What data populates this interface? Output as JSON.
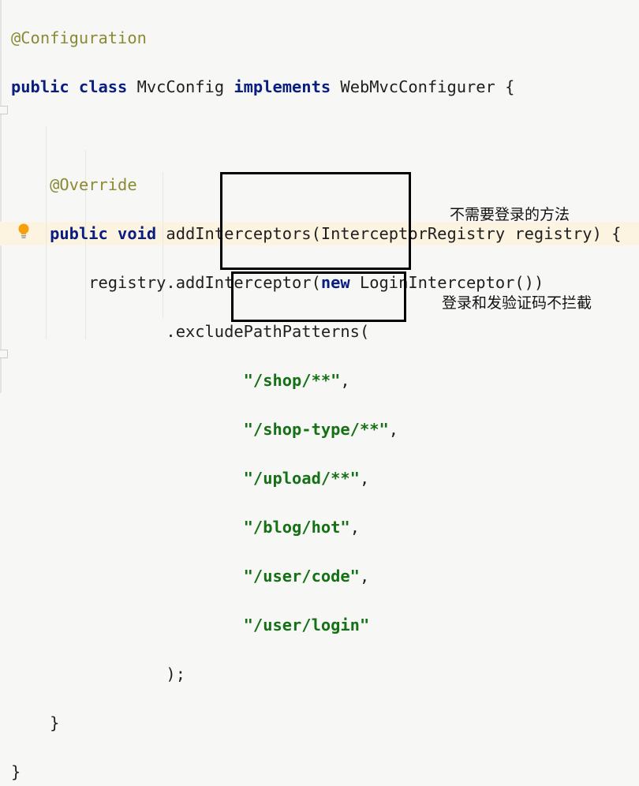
{
  "code": {
    "lines": [
      {
        "annotation": "@Configuration"
      },
      {
        "kw1": "public class",
        "text1": " MvcConfig ",
        "kw2": "implements",
        "text2": " WebMvcConfigurer {"
      },
      {},
      {
        "annotation": "@Override"
      },
      {
        "kw1": "public void",
        "text1": " addInterceptors(InterceptorRegistry registry) {"
      },
      {
        "text1": "registry.addInterceptor(",
        "kw2": "new",
        "text2": " LoginInterceptor())"
      },
      {
        "text1": ".excludePathPatterns("
      },
      {
        "str": "\"/shop/**\"",
        "text1": ","
      },
      {
        "str": "\"/shop-type/**\"",
        "text1": ","
      },
      {
        "str": "\"/upload/**\"",
        "text1": ","
      },
      {
        "str": "\"/blog/hot\"",
        "text1": ","
      },
      {
        "str": "\"/user/code\"",
        "text1": ","
      },
      {
        "str": "\"/user/login\""
      },
      {
        "text1": ");"
      },
      {
        "text1": "}"
      },
      {
        "text1": "}"
      }
    ]
  },
  "notes": {
    "no_login": "不需要登录的方法",
    "login_code": "登录和发验证码不拦截"
  },
  "icons": {
    "intention": "lightbulb-icon"
  },
  "colors": {
    "keyword": "#0a1e80",
    "string": "#167016",
    "annotation": "#8a8a35",
    "highlight": "#fdf3e1"
  }
}
